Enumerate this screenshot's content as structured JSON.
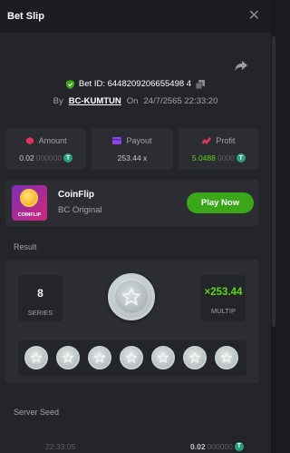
{
  "header": {
    "title": "Bet Slip"
  },
  "bet": {
    "id_label": "Bet ID: 6448209206655498 4",
    "by_label": "By",
    "username": "BC-KUMTUN",
    "on_label": "On",
    "datetime": "24/7/2565 22:33:20"
  },
  "stats": [
    {
      "label": "Amount",
      "value_main": "0.02",
      "value_muted": "000000",
      "icon": "amount-icon"
    },
    {
      "label": "Payout",
      "value_main": "253.44 x",
      "value_muted": "",
      "icon": "payout-icon"
    },
    {
      "label": "Profit",
      "value_main": "5.0488",
      "value_muted": "0000",
      "icon": "profit-icon"
    }
  ],
  "game": {
    "name": "CoinFlip",
    "provider": "BC Original",
    "thumb_label": "COINFLIP",
    "play_label": "Play Now"
  },
  "result": {
    "label": "Result",
    "series_value": "8",
    "series_label": "SERIES",
    "multiplier_value": "×253.44",
    "multiplier_label": "MULTIP"
  },
  "server_seed": {
    "label": "Server Seed"
  },
  "footer": {
    "time": "22:33:05",
    "amount_main": "0.02",
    "amount_muted": "000000"
  },
  "colors": {
    "accent_green": "#3aa619",
    "profit_green": "#5ed61a",
    "tether": "#26a17b"
  }
}
